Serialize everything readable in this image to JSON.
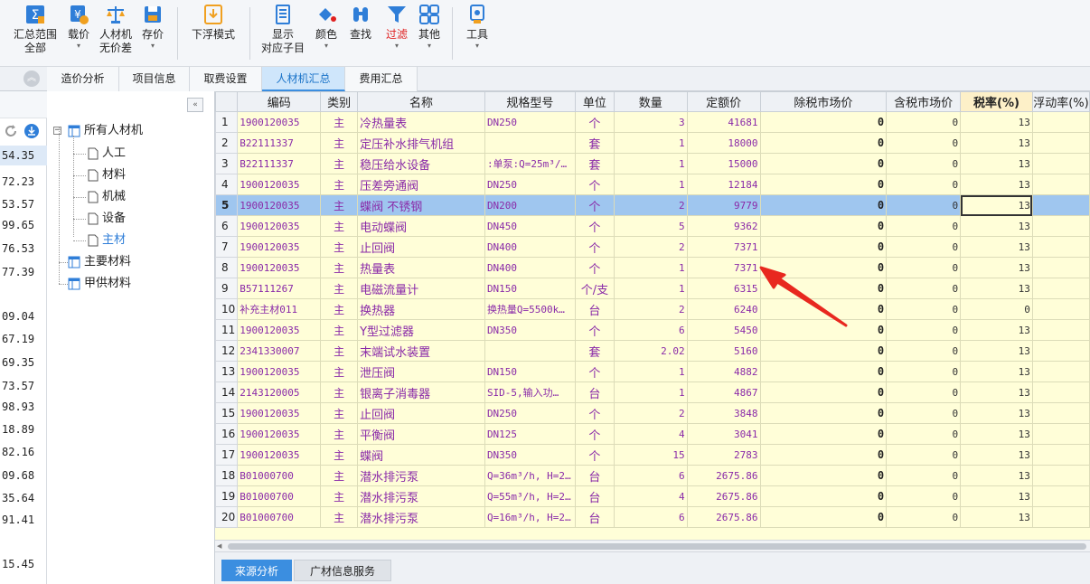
{
  "toolbar": {
    "buttons": [
      {
        "label": "汇总范围\n全部",
        "icon": "sigma-range-icon"
      },
      {
        "label": "载价",
        "icon": "price-load-icon"
      },
      {
        "label": "人材机\n无价差",
        "icon": "scale-balance-icon"
      },
      {
        "label": "存价",
        "icon": "save-price-icon"
      },
      {
        "label": "下浮模式",
        "icon": "download-mode-icon"
      },
      {
        "label": "显示\n对应子目",
        "icon": "list-display-icon"
      },
      {
        "label": "颜色",
        "icon": "paint-bucket-icon"
      },
      {
        "label": "查找",
        "icon": "binoculars-icon"
      },
      {
        "label": "过滤",
        "icon": "funnel-filter-icon"
      },
      {
        "label": "其他",
        "icon": "grid-apps-icon"
      },
      {
        "label": "工具",
        "icon": "wrench-tool-icon"
      }
    ],
    "colors": {
      "accent": "#2f7ed8",
      "filter_label": "#e02020"
    }
  },
  "tabs": [
    {
      "label": "造价分析",
      "active": false
    },
    {
      "label": "项目信息",
      "active": false
    },
    {
      "label": "取费设置",
      "active": false
    },
    {
      "label": "人材机汇总",
      "active": true
    },
    {
      "label": "费用汇总",
      "active": false
    }
  ],
  "left_strip": {
    "values": [
      "54.35",
      "72.23",
      "53.57",
      "99.65",
      "76.53",
      "77.39",
      "09.04",
      "67.19",
      "69.35",
      "73.57",
      "98.93",
      "18.89",
      "82.16",
      "09.68",
      "35.64",
      "91.41",
      "15.45"
    ]
  },
  "tree": {
    "root": "所有人材机",
    "children": [
      "人工",
      "材料",
      "机械",
      "设备",
      "主材"
    ],
    "active_child": "主材",
    "others": [
      "主要材料",
      "甲供材料"
    ]
  },
  "grid": {
    "columns": [
      "",
      "编码",
      "类别",
      "名称",
      "规格型号",
      "单位",
      "数量",
      "定额价",
      "除税市场价",
      "含税市场价",
      "税率(%)",
      "浮动率(%)"
    ],
    "selected_row": 5,
    "rows": [
      {
        "n": "1",
        "code": "1900120035",
        "cat": "主",
        "name": "冷热量表",
        "spec": "DN250",
        "unit": "个",
        "qty": "3",
        "price": "41681",
        "ex": "0",
        "inc": "0",
        "tax": "13"
      },
      {
        "n": "2",
        "code": "B22111337",
        "cat": "主",
        "name": "定压补水排气机组",
        "spec": "",
        "unit": "套",
        "qty": "1",
        "price": "18000",
        "ex": "0",
        "inc": "0",
        "tax": "13"
      },
      {
        "n": "3",
        "code": "B22111337",
        "cat": "主",
        "name": "稳压给水设备",
        "spec": ":单泵:Q=25m³/…",
        "unit": "套",
        "qty": "1",
        "price": "15000",
        "ex": "0",
        "inc": "0",
        "tax": "13"
      },
      {
        "n": "4",
        "code": "1900120035",
        "cat": "主",
        "name": "压差旁通阀",
        "spec": "DN250",
        "unit": "个",
        "qty": "1",
        "price": "12184",
        "ex": "0",
        "inc": "0",
        "tax": "13"
      },
      {
        "n": "5",
        "code": "1900120035",
        "cat": "主",
        "name": "蝶阀 不锈钢",
        "spec": "DN200",
        "unit": "个",
        "qty": "2",
        "price": "9779",
        "ex": "0",
        "inc": "0",
        "tax": "13"
      },
      {
        "n": "6",
        "code": "1900120035",
        "cat": "主",
        "name": "电动蝶阀",
        "spec": "DN450",
        "unit": "个",
        "qty": "5",
        "price": "9362",
        "ex": "0",
        "inc": "0",
        "tax": "13"
      },
      {
        "n": "7",
        "code": "1900120035",
        "cat": "主",
        "name": "止回阀",
        "spec": "DN400",
        "unit": "个",
        "qty": "2",
        "price": "7371",
        "ex": "0",
        "inc": "0",
        "tax": "13"
      },
      {
        "n": "8",
        "code": "1900120035",
        "cat": "主",
        "name": "热量表",
        "spec": "DN400",
        "unit": "个",
        "qty": "1",
        "price": "7371",
        "ex": "0",
        "inc": "0",
        "tax": "13"
      },
      {
        "n": "9",
        "code": "B57111267",
        "cat": "主",
        "name": "电磁流量计",
        "spec": "DN150",
        "unit": "个/支",
        "qty": "1",
        "price": "6315",
        "ex": "0",
        "inc": "0",
        "tax": "13"
      },
      {
        "n": "10",
        "code": "补充主材011",
        "cat": "主",
        "name": "换热器",
        "spec": "换热量Q=5500k…",
        "unit": "台",
        "qty": "2",
        "price": "6240",
        "ex": "0",
        "inc": "0",
        "tax": "0"
      },
      {
        "n": "11",
        "code": "1900120035",
        "cat": "主",
        "name": "Y型过滤器",
        "spec": "DN350",
        "unit": "个",
        "qty": "6",
        "price": "5450",
        "ex": "0",
        "inc": "0",
        "tax": "13"
      },
      {
        "n": "12",
        "code": "2341330007",
        "cat": "主",
        "name": "末端试水装置",
        "spec": "",
        "unit": "套",
        "qty": "2.02",
        "price": "5160",
        "ex": "0",
        "inc": "0",
        "tax": "13"
      },
      {
        "n": "13",
        "code": "1900120035",
        "cat": "主",
        "name": "泄压阀",
        "spec": "DN150",
        "unit": "个",
        "qty": "1",
        "price": "4882",
        "ex": "0",
        "inc": "0",
        "tax": "13"
      },
      {
        "n": "14",
        "code": "2143120005",
        "cat": "主",
        "name": "银离子消毒器",
        "spec": "SID-5,输入功…",
        "unit": "台",
        "qty": "1",
        "price": "4867",
        "ex": "0",
        "inc": "0",
        "tax": "13"
      },
      {
        "n": "15",
        "code": "1900120035",
        "cat": "主",
        "name": "止回阀",
        "spec": "DN250",
        "unit": "个",
        "qty": "2",
        "price": "3848",
        "ex": "0",
        "inc": "0",
        "tax": "13"
      },
      {
        "n": "16",
        "code": "1900120035",
        "cat": "主",
        "name": "平衡阀",
        "spec": "DN125",
        "unit": "个",
        "qty": "4",
        "price": "3041",
        "ex": "0",
        "inc": "0",
        "tax": "13"
      },
      {
        "n": "17",
        "code": "1900120035",
        "cat": "主",
        "name": "蝶阀",
        "spec": "DN350",
        "unit": "个",
        "qty": "15",
        "price": "2783",
        "ex": "0",
        "inc": "0",
        "tax": "13"
      },
      {
        "n": "18",
        "code": "B01000700",
        "cat": "主",
        "name": "潜水排污泵",
        "spec": "Q=36m³/h, H=2…",
        "unit": "台",
        "qty": "6",
        "price": "2675.86",
        "ex": "0",
        "inc": "0",
        "tax": "13"
      },
      {
        "n": "19",
        "code": "B01000700",
        "cat": "主",
        "name": "潜水排污泵",
        "spec": "Q=55m³/h, H=2…",
        "unit": "台",
        "qty": "4",
        "price": "2675.86",
        "ex": "0",
        "inc": "0",
        "tax": "13"
      },
      {
        "n": "20",
        "code": "B01000700",
        "cat": "主",
        "name": "潜水排污泵",
        "spec": "Q=16m³/h, H=2…",
        "unit": "台",
        "qty": "6",
        "price": "2675.86",
        "ex": "0",
        "inc": "0",
        "tax": "13"
      }
    ]
  },
  "bottom_tabs": [
    {
      "label": "来源分析",
      "active": true
    },
    {
      "label": "广材信息服务",
      "active": false
    }
  ],
  "annotation": {
    "color": "#e8281f"
  }
}
